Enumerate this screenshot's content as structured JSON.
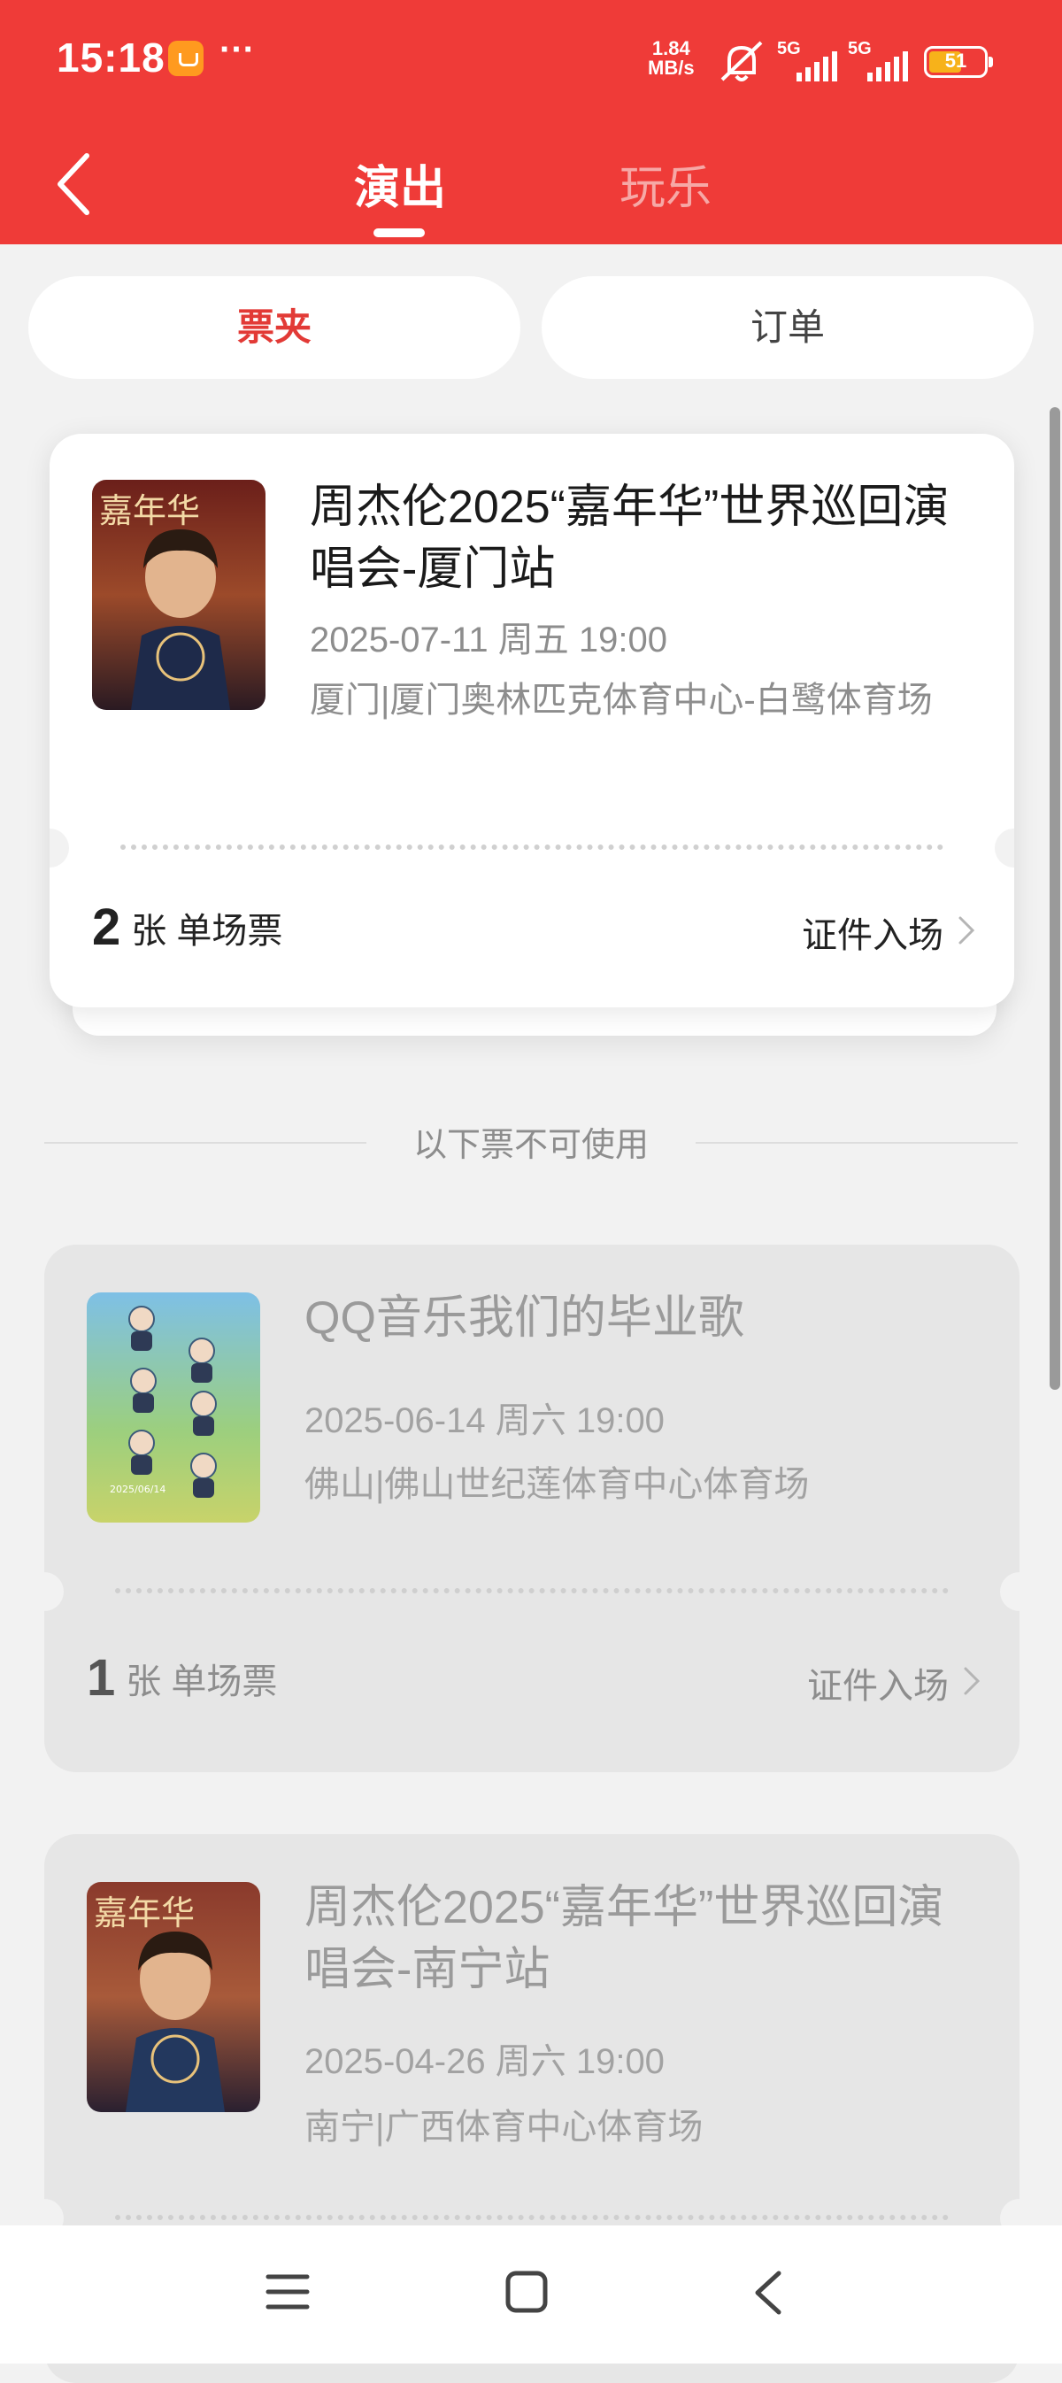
{
  "status_bar": {
    "time": "15:18",
    "net_speed_value": "1.84",
    "net_speed_unit": "MB/s",
    "sig1": "5G",
    "sig2": "5G",
    "battery": "51",
    "more": "···"
  },
  "nav": {
    "tab_show": "演出",
    "tab_fun": "玩乐"
  },
  "segments": {
    "wallet": "票夹",
    "orders": "订单"
  },
  "divider_label": "以下票不可使用",
  "tickets": [
    {
      "title": "周杰伦2025“嘉年华”世界巡回演唱会-厦门站",
      "date": "2025-07-11 周五 19:00",
      "venue": "厦门|厦门奥林匹克体育中心-白鹭体育场",
      "qty": "2",
      "qty_unit": "张 单场票",
      "entry": "证件入场",
      "usable": true
    },
    {
      "title": "QQ音乐我们的毕业歌",
      "date": "2025-06-14 周六 19:00",
      "venue": "佛山|佛山世纪莲体育中心体育场",
      "qty": "1",
      "qty_unit": "张 单场票",
      "entry": "证件入场",
      "usable": false
    },
    {
      "title": "周杰伦2025“嘉年华”世界巡回演唱会-南宁站",
      "date": "2025-04-26 周六 19:00",
      "venue": "南宁|广西体育中心体育场",
      "usable": false
    }
  ],
  "posters": {
    "carnival_text": "嘉年华",
    "grad_date": "2025/06/14"
  },
  "colors": {
    "brand_red": "#ef3b38",
    "active_tab_text": "#e23a36",
    "background": "#f2f2f2"
  },
  "icons": {
    "back": "chevron-left-icon",
    "chevron": "chevron-right-icon",
    "mute": "bell-off-icon",
    "menu": "menu-icon",
    "home": "home-square-icon",
    "nav_back": "nav-back-icon"
  }
}
